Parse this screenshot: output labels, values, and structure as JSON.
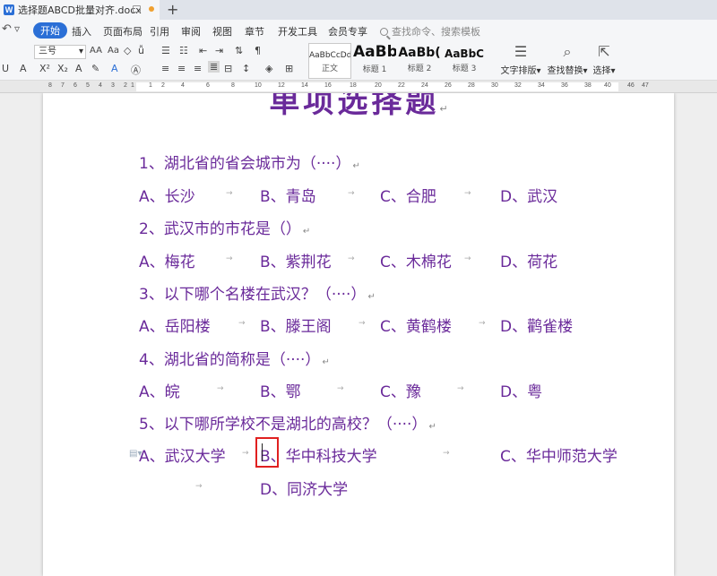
{
  "titlebar": {
    "doc_tab_title": "选择题ABCD批量对齐.docx",
    "new_tab": "+"
  },
  "menu": {
    "items": [
      "开始",
      "插入",
      "页面布局",
      "引用",
      "审阅",
      "视图",
      "章节",
      "开发工具",
      "会员专享"
    ],
    "active_index": 0,
    "search_placeholder": "查找命令、搜索模板"
  },
  "ribbon": {
    "font_size": "三号",
    "styles": [
      {
        "sample": "AaBbCcDd",
        "name": "正文"
      },
      {
        "sample": "AaBb",
        "name": "标题 1"
      },
      {
        "sample": "AaBb(",
        "name": "标题 2"
      },
      {
        "sample": "AaBbC",
        "name": "标题 3"
      }
    ],
    "text_layout": "文字排版",
    "find_replace": "查找替换",
    "select": "选择"
  },
  "ruler": {
    "numbers": [
      "8",
      "7",
      "6",
      "5",
      "4",
      "3",
      "2",
      "1",
      "",
      "1",
      "2",
      "4",
      "6",
      "8",
      "10",
      "12",
      "14",
      "16",
      "18",
      "20",
      "22",
      "24",
      "26",
      "28",
      "30",
      "32",
      "34",
      "36",
      "38",
      "40",
      "42",
      "44",
      "",
      "46",
      "47"
    ]
  },
  "document": {
    "title": "单项选择题",
    "questions": [
      {
        "text": "1、湖北省的省会城市为（····）",
        "options": [
          "A、长沙",
          "B、青岛",
          "C、合肥",
          "D、武汉"
        ]
      },
      {
        "text": "2、武汉市的市花是（）",
        "options": [
          "A、梅花",
          "B、紫荆花",
          "C、木棉花",
          "D、荷花"
        ]
      },
      {
        "text": "3、以下哪个名楼在武汉？（····）",
        "options": [
          "A、岳阳楼",
          "B、滕王阁",
          "C、黄鹤楼",
          "D、鹳雀楼"
        ]
      },
      {
        "text": "4、湖北省的简称是（····）",
        "options": [
          "A、皖",
          "B、鄂",
          "C、豫",
          "D、粤"
        ]
      },
      {
        "text": "5、以下哪所学校不是湖北的高校？（····）",
        "options": [
          "A、武汉大学",
          "B、华中科技大学",
          "C、华中师范大学",
          "D、同济大学"
        ]
      }
    ]
  }
}
